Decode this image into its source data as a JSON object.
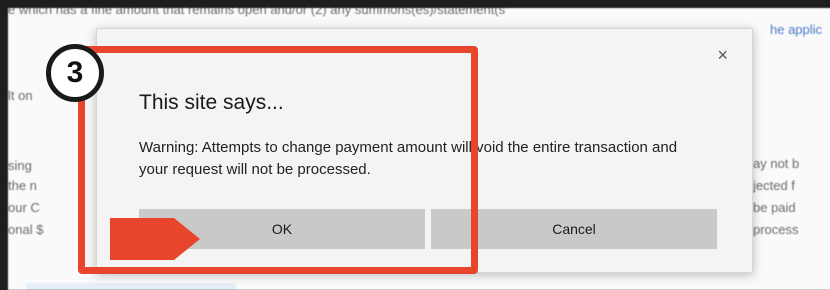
{
  "background": {
    "lines": [
      "e which has a fine amount that remains open and/or (2) any summons(es)/statement(s",
      "he applic",
      "lt on",
      "ay not b",
      "sing",
      "the n",
      "jected f",
      "our C",
      "be paid",
      "onal $",
      "process"
    ]
  },
  "dialog": {
    "title": "This site says...",
    "message": "Warning: Attempts to change payment amount will void the entire transaction and your request will not be processed.",
    "close_icon": "×",
    "ok_label": "OK",
    "cancel_label": "Cancel"
  },
  "annotation": {
    "step_number": "3",
    "highlight_color": "#e8452c"
  }
}
